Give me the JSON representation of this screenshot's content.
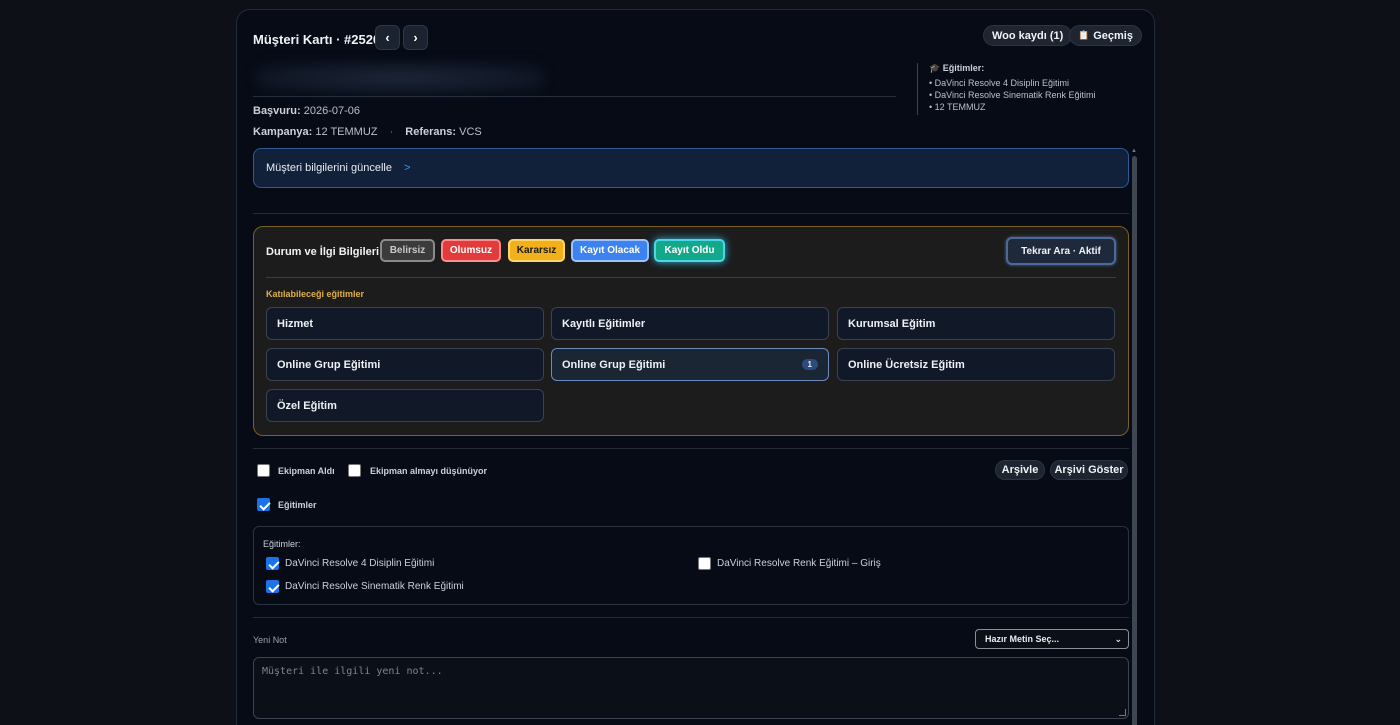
{
  "header": {
    "title": "Müşteri Kartı · #2520",
    "prev_icon": "‹",
    "next_icon": "›",
    "woo_label": "Woo kaydı (1)",
    "history_icon": "📋",
    "history_label": "Geçmiş"
  },
  "info": {
    "basvuru_label": "Başvuru:",
    "basvuru_value": "2026-07-06",
    "kampanya_label": "Kampanya:",
    "kampanya_value": "12 TEMMUZ",
    "separator": "·",
    "referans_label": "Referans:",
    "referans_value": "VCS"
  },
  "trainings_panel": {
    "title": "🎓 Eğitimler:",
    "items": [
      "• DaVinci Resolve 4 Disiplin Eğitimi",
      "• DaVinci Resolve Sinematik Renk Eğitimi",
      "• 12 TEMMUZ"
    ]
  },
  "update": {
    "label": "Müşteri bilgilerini güncelle",
    "chevron": ">"
  },
  "status": {
    "label": "Durum ve İlgi Bilgileri",
    "buttons": [
      "Belirsiz",
      "Olumsuz",
      "Kararsız",
      "Kayıt Olacak",
      "Kayıt Oldu"
    ],
    "active": "Kayıt Oldu",
    "tekrar": "Tekrar Ara · Aktif",
    "section_title": "Katılabileceği eğitimler",
    "options": [
      {
        "label": "Hizmet"
      },
      {
        "label": "Kayıtlı Eğitimler"
      },
      {
        "label": "Kurumsal Eğitim"
      },
      {
        "label": "Online Grup Eğitimi"
      },
      {
        "label": "Online Grup Eğitimi",
        "badge": "1",
        "active": true
      },
      {
        "label": "Online Ücretsiz Eğitim"
      },
      {
        "label": "Özel Eğitim"
      }
    ]
  },
  "checks": {
    "ekipman_aldi": "Ekipman Aldı",
    "ekipman_dusunuyor": "Ekipman almayı düşünüyor",
    "arsivle": "Arşivle",
    "arsivi_goster": "Arşivi Göster",
    "egitimler": "Eğitimler"
  },
  "egitimler_box": {
    "title": "Eğitimler:",
    "items": [
      {
        "label": "DaVinci Resolve 4 Disiplin Eğitimi",
        "checked": true
      },
      {
        "label": "DaVinci Resolve Sinematik Renk Eğitimi",
        "checked": true
      },
      {
        "label": "DaVinci Resolve Renk Eğitimi – Giriş",
        "checked": false
      }
    ]
  },
  "note": {
    "label": "Yeni Not",
    "select_value": "Hazır Metin Seç...",
    "placeholder": "Müşteri ile ilgili yeni not..."
  }
}
